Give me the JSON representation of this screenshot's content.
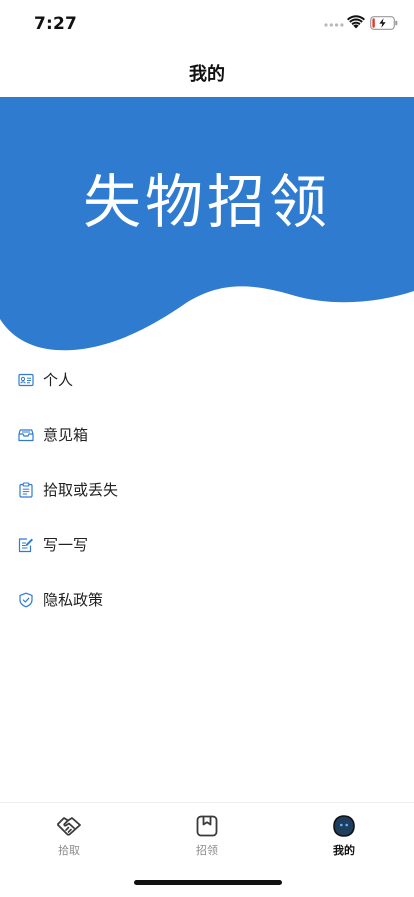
{
  "status_bar": {
    "time": "7:27"
  },
  "nav": {
    "title": "我的"
  },
  "banner": {
    "title": "失物招领",
    "color": "#2e7bcf"
  },
  "menu": {
    "items": [
      {
        "label": "个人",
        "icon": "id-card-icon"
      },
      {
        "label": "意见箱",
        "icon": "inbox-icon"
      },
      {
        "label": "拾取或丢失",
        "icon": "clipboard-icon"
      },
      {
        "label": "写一写",
        "icon": "edit-icon"
      },
      {
        "label": "隐私政策",
        "icon": "shield-icon"
      }
    ],
    "icon_color": "#2e7bcf"
  },
  "tabs": [
    {
      "label": "拾取",
      "icon": "handshake-icon",
      "active": false
    },
    {
      "label": "招领",
      "icon": "box-icon",
      "active": false
    },
    {
      "label": "我的",
      "icon": "profile-icon",
      "active": true
    }
  ]
}
